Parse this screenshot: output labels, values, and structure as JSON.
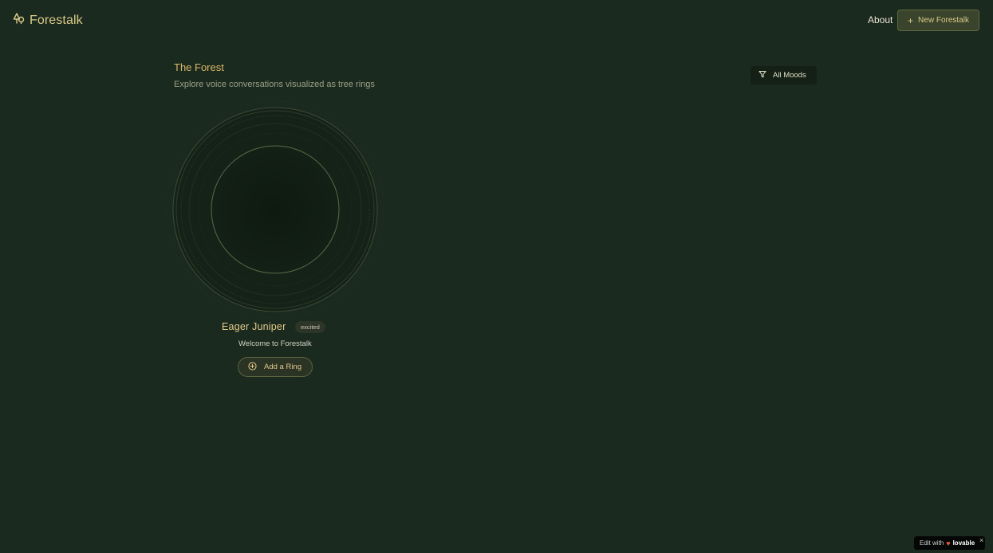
{
  "header": {
    "brand": "Forestalk",
    "nav_about": "About",
    "new_button": "New Forestalk",
    "new_button_icon": "+"
  },
  "section": {
    "title": "The Forest",
    "subtitle": "Explore voice conversations visualized as tree rings"
  },
  "filter": {
    "label": "All Moods",
    "icon": "filter-icon"
  },
  "trees": [
    {
      "name": "Eager Juniper",
      "mood": "excited",
      "description": "Welcome to Forestalk",
      "action_label": "Add a Ring",
      "action_icon": "plus-circle-icon"
    }
  ],
  "badge": {
    "prefix": "Edit with",
    "brand": "lovable",
    "heart": "♥",
    "close": "×"
  },
  "colors": {
    "background": "#1b2a1e",
    "accent": "#d9b86a",
    "ring": "#5a6a48"
  }
}
